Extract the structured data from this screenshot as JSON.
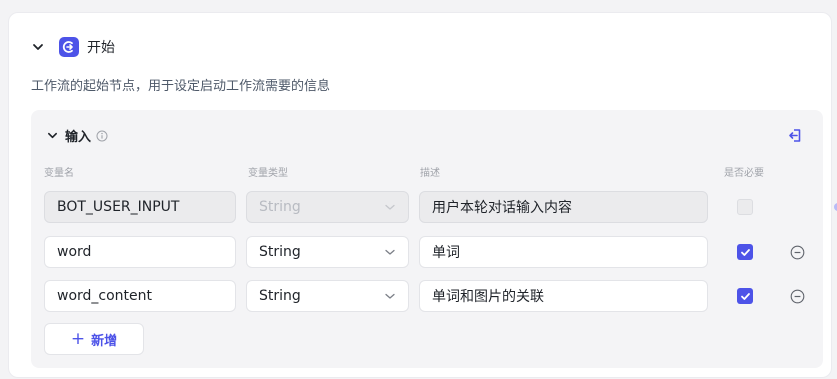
{
  "node": {
    "title": "开始",
    "description": "工作流的起始节点，用于设定启动工作流需要的信息",
    "accent_color": "#4d53e8"
  },
  "input_section": {
    "title": "输入",
    "info_icon": "info-icon",
    "action_icon": "import-icon",
    "columns": {
      "name": "变量名",
      "type": "变量类型",
      "description": "描述",
      "required": "是否必要"
    },
    "rows": [
      {
        "name": "BOT_USER_INPUT",
        "type": "String",
        "description": "用户本轮对话输入内容",
        "required": false,
        "disabled": true
      },
      {
        "name": "word",
        "type": "String",
        "description": "单词",
        "required": true,
        "disabled": false
      },
      {
        "name": "word_content",
        "type": "String",
        "description": "单词和图片的关联",
        "required": true,
        "disabled": false
      }
    ],
    "add_label": "新增"
  }
}
